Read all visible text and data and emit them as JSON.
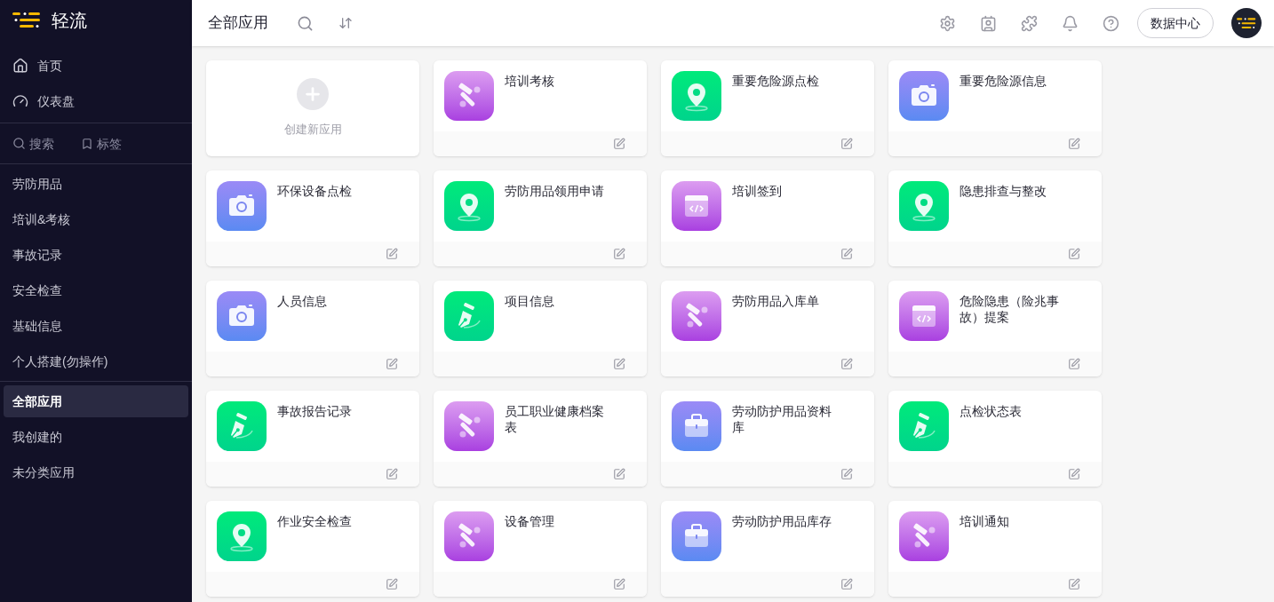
{
  "brand": {
    "name": "轻流"
  },
  "sidebar": {
    "nav": [
      {
        "kind": "home",
        "label": "首页"
      },
      {
        "kind": "dashboard",
        "label": "仪表盘"
      }
    ],
    "tools": [
      {
        "kind": "search",
        "label": "搜索"
      },
      {
        "kind": "bookmark",
        "label": "标签"
      }
    ],
    "groups": [
      {
        "label": "劳防用品",
        "selected": false
      },
      {
        "label": "培训&考核",
        "selected": false
      },
      {
        "label": "事故记录",
        "selected": false
      },
      {
        "label": "安全检查",
        "selected": false
      },
      {
        "label": "基础信息",
        "selected": false
      },
      {
        "label": "个人搭建(勿操作)",
        "selected": false
      }
    ],
    "views": [
      {
        "label": "全部应用",
        "selected": true
      },
      {
        "label": "我创建的",
        "selected": false
      },
      {
        "label": "未分类应用",
        "selected": false
      }
    ]
  },
  "header": {
    "title": "全部应用",
    "data_center_button": "数据中心"
  },
  "create_card": {
    "label": "创建新应用"
  },
  "apps": [
    {
      "title": "培训考核",
      "kind": "tools"
    },
    {
      "title": "重要危险源点检",
      "kind": "pin"
    },
    {
      "title": "重要危险源信息",
      "kind": "camera"
    },
    {
      "title": "环保设备点检",
      "kind": "camera"
    },
    {
      "title": "劳防用品领用申请",
      "kind": "pin"
    },
    {
      "title": "培训签到",
      "kind": "code"
    },
    {
      "title": "隐患排查与整改",
      "kind": "pin"
    },
    {
      "title": "人员信息",
      "kind": "camera"
    },
    {
      "title": "项目信息",
      "kind": "pen"
    },
    {
      "title": "劳防用品入库单",
      "kind": "tools"
    },
    {
      "title": "危险隐患（险兆事故）提案",
      "kind": "code"
    },
    {
      "title": "事故报告记录",
      "kind": "pen"
    },
    {
      "title": "员工职业健康档案表",
      "kind": "tools"
    },
    {
      "title": "劳动防护用品资料库",
      "kind": "toolbox"
    },
    {
      "title": "点检状态表",
      "kind": "pen"
    },
    {
      "title": "作业安全检查",
      "kind": "pin"
    },
    {
      "title": "设备管理",
      "kind": "tools"
    },
    {
      "title": "劳动防护用品库存",
      "kind": "toolbox"
    },
    {
      "title": "培训通知",
      "kind": "tools"
    }
  ]
}
